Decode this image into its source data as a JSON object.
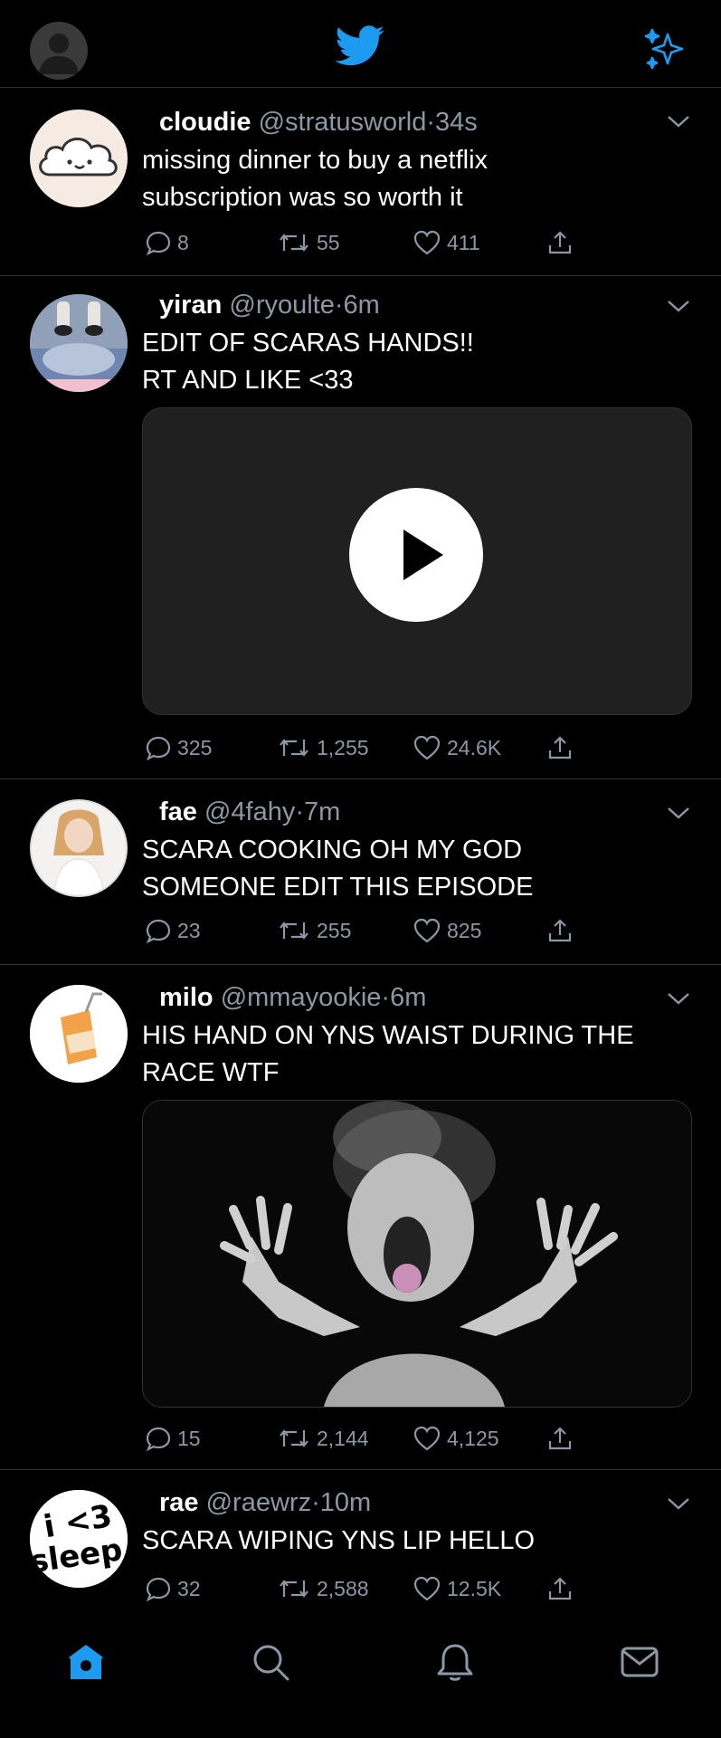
{
  "colors": {
    "accent": "#1d9bf0",
    "muted": "#8b98a5",
    "background": "#000000",
    "divider": "#2f3336"
  },
  "header": {
    "avatar_icon": "default-avatar-icon",
    "logo_icon": "twitter-bird-icon",
    "sparkle_icon": "sparkle-icon"
  },
  "tweets": [
    {
      "name": "cloudie",
      "handle": "@stratusworld",
      "sep": "·",
      "time": "34s",
      "lines": [
        "missing dinner to buy a netflix",
        "subscription was so worth it"
      ],
      "replies": "8",
      "retweets": "55",
      "likes": "411"
    },
    {
      "name": "yiran",
      "handle": "@ryoulte",
      "sep": "·",
      "time": "6m",
      "lines": [
        "EDIT OF SCARAS HANDS!!",
        "RT AND LIKE <33"
      ],
      "replies": "325",
      "retweets": "1,255",
      "likes": "24.6K",
      "media": "video"
    },
    {
      "name": "fae",
      "handle": "@4fahy",
      "sep": "·",
      "time": "7m",
      "lines": [
        "SCARA COOKING OH MY GOD",
        "SOMEONE EDIT THIS EPISODE"
      ],
      "replies": "23",
      "retweets": "255",
      "likes": "825"
    },
    {
      "name": "milo",
      "handle": "@mmayookie",
      "sep": "·",
      "time": "6m",
      "lines": [
        "HIS HAND ON YNS WAIST DURING THE",
        "RACE WTF"
      ],
      "replies": "15",
      "retweets": "2,144",
      "likes": "4,125",
      "media": "image"
    },
    {
      "name": "rae",
      "handle": "@raewrz",
      "sep": "·",
      "time": "10m",
      "lines": [
        "SCARA WIPING YNS LIP HELLO"
      ],
      "replies": "32",
      "retweets": "2,588",
      "likes": "12.5K",
      "avatar_text": {
        "top": "i <3",
        "bottom": "sleep"
      }
    }
  ],
  "tabbar": [
    "home-icon",
    "search-icon",
    "notifications-icon",
    "messages-icon"
  ]
}
